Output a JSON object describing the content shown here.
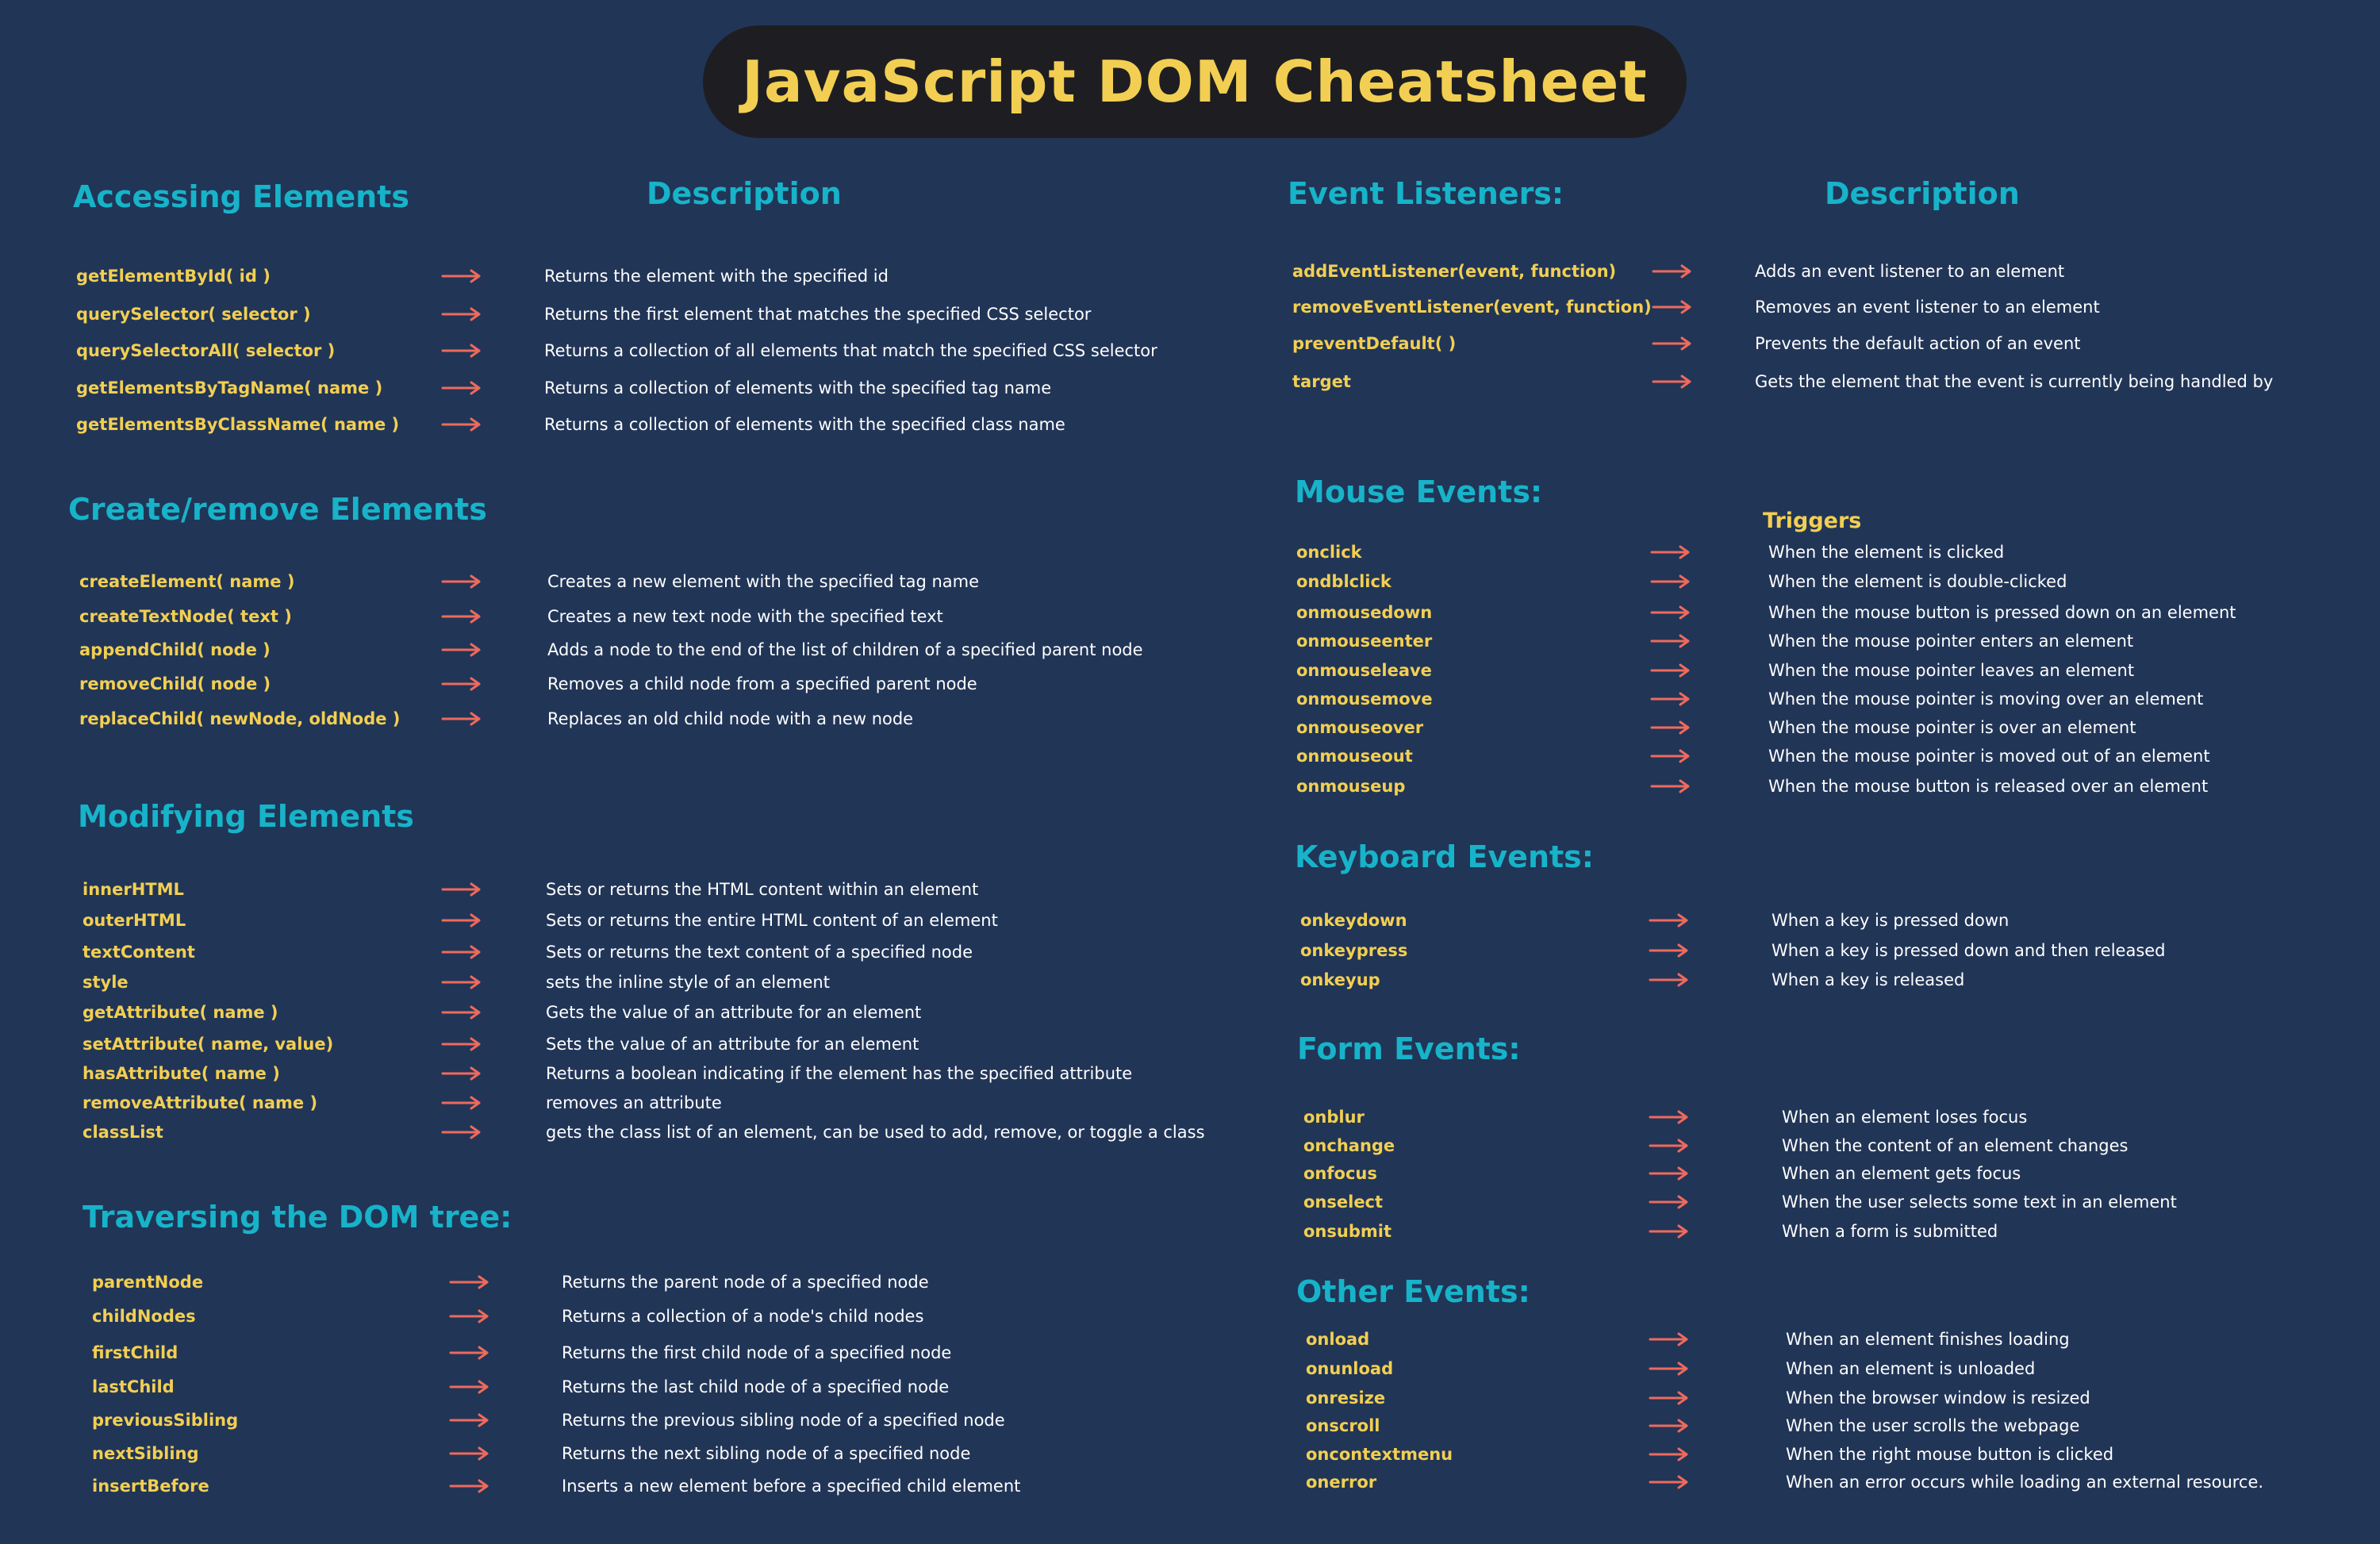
{
  "title": "JavaScript DOM Cheatsheet",
  "colors": {
    "background": "#213557",
    "title_pill": "#1e1e22",
    "heading": "#17b3c9",
    "method": "#f2cf52",
    "description": "#ffffff",
    "arrow": "#ee6a5c"
  },
  "icons": {
    "arrow": "right-arrow-icon"
  },
  "accessing": {
    "title": "Accessing Elements",
    "desc_head": "Description",
    "items": [
      {
        "method": "getElementById( id )",
        "desc": "Returns the element with the specified id"
      },
      {
        "method": "querySelector( selector )",
        "desc": "Returns the first element that matches the specified CSS  selector"
      },
      {
        "method": "querySelectorAll( selector )",
        "desc": "Returns a collection of all elements that match the specified CSS selector"
      },
      {
        "method": "getElementsByTagName( name )",
        "desc": "Returns a collection of elements with the specified tag name"
      },
      {
        "method": "getElementsByClassName( name )",
        "desc": "Returns a collection of elements with the specified class name"
      }
    ]
  },
  "create": {
    "title": "Create/remove Elements",
    "items": [
      {
        "method": "createElement( name )",
        "desc": "Creates a new element with the specified tag name"
      },
      {
        "method": "createTextNode( text )",
        "desc": "Creates a new text node with the specified text"
      },
      {
        "method": "appendChild( node )",
        "desc": "Adds a node to the end of the list of children of a specified parent node"
      },
      {
        "method": "removeChild( node )",
        "desc": "Removes a child node from a specified parent node"
      },
      {
        "method": "replaceChild( newNode, oldNode )",
        "desc": "Replaces an old child node with a new node"
      }
    ]
  },
  "modifying": {
    "title": "Modifying Elements",
    "items": [
      {
        "method": "innerHTML",
        "desc": "Sets or returns the HTML content within an element"
      },
      {
        "method": "outerHTML",
        "desc": "Sets or returns the entire HTML content of an element"
      },
      {
        "method": "textContent",
        "desc": "Sets or returns the text content of a specified node"
      },
      {
        "method": "style",
        "desc": "sets the inline style of an element"
      },
      {
        "method": "getAttribute( name )",
        "desc": "Gets the value of an attribute for an element"
      },
      {
        "method": "setAttribute( name, value)",
        "desc": "Sets the value of an attribute for an element"
      },
      {
        "method": "hasAttribute( name )",
        "desc": "Returns a boolean indicating if the element has the specified attribute"
      },
      {
        "method": "removeAttribute( name )",
        "desc": "removes an attribute"
      },
      {
        "method": "classList",
        "desc": "gets the class list of an element, can be used to add, remove, or toggle a class"
      }
    ]
  },
  "traversing": {
    "title": "Traversing the DOM tree:",
    "items": [
      {
        "method": "parentNode",
        "desc": "Returns the parent node of a specified node"
      },
      {
        "method": "childNodes",
        "desc": "Returns a collection of a node's child nodes"
      },
      {
        "method": "firstChild",
        "desc": "Returns the first child node of a specified node"
      },
      {
        "method": "lastChild",
        "desc": "Returns the last child node of a specified node"
      },
      {
        "method": "previousSibling",
        "desc": "Returns the previous sibling node of a specified node"
      },
      {
        "method": "nextSibling",
        "desc": "Returns the next sibling node of a specified node"
      },
      {
        "method": "insertBefore",
        "desc": "Inserts a new element before a specified child element"
      }
    ]
  },
  "listeners": {
    "title": "Event Listeners:",
    "desc_head": "Description",
    "items": [
      {
        "method": "addEventListener(event, function)",
        "desc": "Adds an event listener to an element"
      },
      {
        "method": "removeEventListener(event, function)",
        "desc": "Removes an event listener to an element"
      },
      {
        "method": "preventDefault( )",
        "desc": "Prevents the default action of an event"
      },
      {
        "method": "target",
        "desc": "Gets the element that the event is currently being handled by"
      }
    ]
  },
  "mouse": {
    "title": "Mouse Events:",
    "triggers_head": "Triggers",
    "items": [
      {
        "method": "onclick",
        "desc": "When the element is clicked"
      },
      {
        "method": "ondblclick",
        "desc": "When the element is double-clicked"
      },
      {
        "method": "onmousedown",
        "desc": "When the mouse button is pressed down on an element"
      },
      {
        "method": "onmouseenter",
        "desc": "When the mouse pointer enters an element"
      },
      {
        "method": "onmouseleave",
        "desc": "When the mouse pointer leaves an element"
      },
      {
        "method": "onmousemove",
        "desc": "When the mouse pointer is moving over an element"
      },
      {
        "method": "onmouseover",
        "desc": "When the mouse pointer is over an element"
      },
      {
        "method": "onmouseout",
        "desc": "When the mouse pointer is moved out of an element"
      },
      {
        "method": "onmouseup",
        "desc": "When the mouse button is released over an element"
      }
    ]
  },
  "keyboard": {
    "title": "Keyboard Events:",
    "items": [
      {
        "method": "onkeydown",
        "desc": "When a key is pressed down"
      },
      {
        "method": "onkeypress",
        "desc": "When a key is pressed down and then released"
      },
      {
        "method": "onkeyup",
        "desc": "When a key is released"
      }
    ]
  },
  "form": {
    "title": "Form Events:",
    "items": [
      {
        "method": "onblur",
        "desc": "When an element loses focus"
      },
      {
        "method": "onchange",
        "desc": "When the content of an element changes"
      },
      {
        "method": "onfocus",
        "desc": "When an element gets focus"
      },
      {
        "method": "onselect",
        "desc": "When the user selects some text in an element"
      },
      {
        "method": "onsubmit",
        "desc": "When a form is submitted"
      }
    ]
  },
  "other": {
    "title": "Other  Events:",
    "items": [
      {
        "method": "onload",
        "desc": "When an element finishes loading"
      },
      {
        "method": "onunload",
        "desc": "When an element is unloaded"
      },
      {
        "method": "onresize",
        "desc": "When the browser window is resized"
      },
      {
        "method": "onscroll",
        "desc": "When the user scrolls the webpage"
      },
      {
        "method": "oncontextmenu",
        "desc": "When the right mouse button is clicked"
      },
      {
        "method": "onerror",
        "desc": "When an error occurs while loading an external resource."
      }
    ]
  }
}
